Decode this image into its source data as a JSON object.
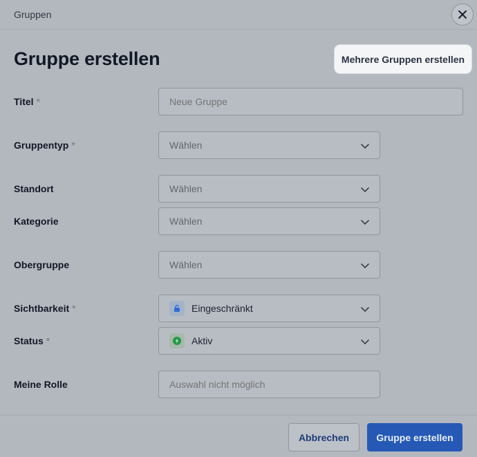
{
  "header": {
    "title": "Gruppen",
    "close_icon": "close-icon"
  },
  "page": {
    "title": "Gruppe erstellen",
    "multi_button": "Mehrere Gruppen erstellen"
  },
  "required_marker": "*",
  "fields": {
    "titel": {
      "label": "Titel",
      "required": true,
      "placeholder": "Neue Gruppe",
      "value": ""
    },
    "gruppentyp": {
      "label": "Gruppentyp",
      "required": true,
      "value": "Wählen"
    },
    "standort": {
      "label": "Standort",
      "required": false,
      "value": "Wählen"
    },
    "kategorie": {
      "label": "Kategorie",
      "required": false,
      "value": "Wählen"
    },
    "obergruppe": {
      "label": "Obergruppe",
      "required": false,
      "value": "Wählen"
    },
    "sichtbarkeit": {
      "label": "Sichtbarkeit",
      "required": true,
      "value": "Eingeschränkt",
      "icon": "lock-icon",
      "icon_color": "#2b6cd6"
    },
    "status": {
      "label": "Status",
      "required": true,
      "value": "Aktiv",
      "icon": "bolt-icon",
      "icon_color": "#1f9a45"
    },
    "meine_rolle": {
      "label": "Meine Rolle",
      "required": false,
      "placeholder": "Auswahl nicht möglich",
      "value": ""
    }
  },
  "footer": {
    "cancel_label": "Abbrechen",
    "submit_label": "Gruppe erstellen"
  },
  "colors": {
    "primary": "#2559b5",
    "overlay": "#b3b8bf"
  }
}
